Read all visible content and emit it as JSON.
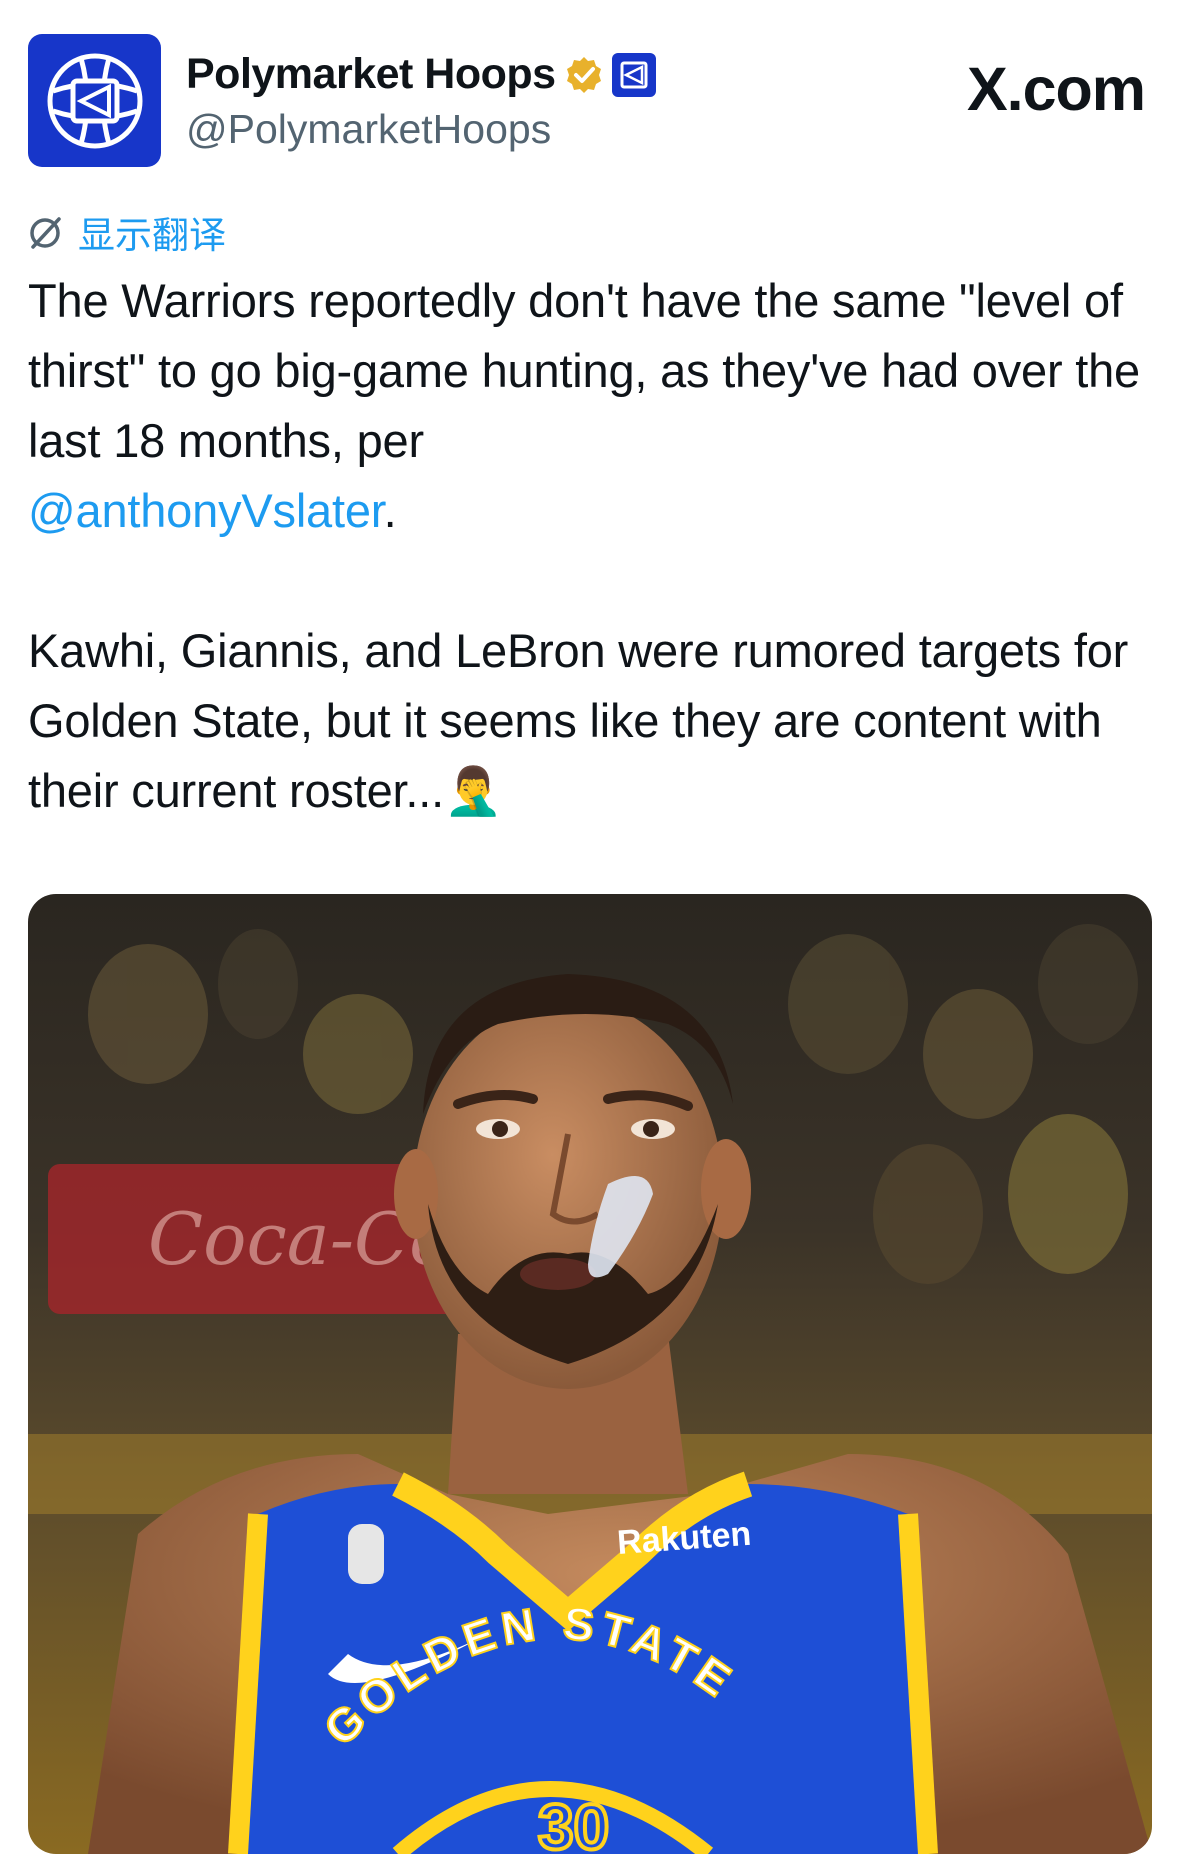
{
  "header": {
    "display_name": "Polymarket Hoops",
    "handle": "@PolymarketHoops",
    "source": "X.com"
  },
  "translate": {
    "label": "显示翻译"
  },
  "tweet": {
    "text_part1": "The Warriors reportedly don't have the same \"level of thirst\" to go big-game hunting, as they've had over the last 18 months, per\n",
    "mention": "@anthonyVslater",
    "text_part2": ".\n\nKawhi, Giannis, and LeBron were rumored targets for Golden State, but it seems like they are content with their current roster...",
    "emoji": "🤦‍♂️"
  },
  "media": {
    "jersey_sponsor": "Rakuten",
    "jersey_team": "GOLDEN STATE",
    "jersey_number": "30",
    "banner_text": "Coca-Cola"
  },
  "colors": {
    "link": "#1d9bf0",
    "brand": "#1736c9",
    "verified": "#e8b12c",
    "jersey": "#1e4fd6",
    "jersey_trim": "#ffd21c"
  }
}
